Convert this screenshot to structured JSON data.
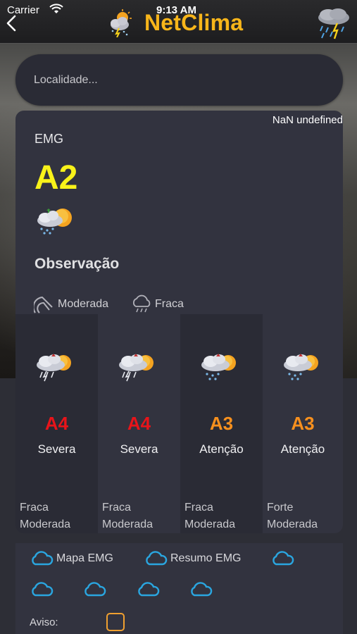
{
  "status_bar": {
    "carrier": "Carrier",
    "time": "9:13 AM"
  },
  "header": {
    "title": "NetClima",
    "title_color": "#f7b51a"
  },
  "search": {
    "placeholder": "Localidade...",
    "value": ""
  },
  "forecast": {
    "date_label": "NaN undefined",
    "region": "EMG",
    "level": "A2",
    "level_color": "#f8f21a",
    "observation_title": "Observação",
    "wind_label": "Moderada",
    "rain_label": "Fraca",
    "columns": [
      {
        "level": "A4",
        "level_color": "#e8141a",
        "severity": "Severa",
        "line1": "Fraca",
        "line2": "Moderada",
        "icon": "thunderstorm-sun-icon"
      },
      {
        "level": "A4",
        "level_color": "#e8141a",
        "severity": "Severa",
        "line1": "Fraca",
        "line2": "Moderada",
        "icon": "thunderstorm-sun-icon"
      },
      {
        "level": "A3",
        "level_color": "#f7901e",
        "severity": "Atenção",
        "line1": "Fraca",
        "line2": "Moderada",
        "icon": "rain-sun-icon"
      },
      {
        "level": "A3",
        "level_color": "#f7901e",
        "severity": "Atenção",
        "line1": "Forte",
        "line2": "Moderada",
        "icon": "rain-sun-icon"
      }
    ]
  },
  "links": {
    "mapa": "Mapa EMG",
    "resumo": "Resumo EMG",
    "aviso_label": "Aviso:"
  },
  "colors": {
    "cloud_link": "#2aa6e0",
    "checkbox_border": "#f0a030"
  }
}
